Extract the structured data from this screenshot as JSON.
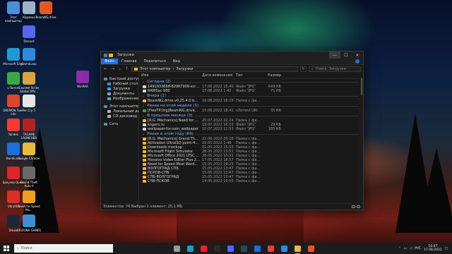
{
  "desktop": {
    "icons": [
      {
        "label": "Этот компьютер",
        "color": "#4a90d9"
      },
      {
        "label": "Корзина",
        "color": "#9fb3c8"
      },
      {
        "label": "BeamNG.drive",
        "color": "#e35a20"
      },
      {
        "label": "Discord",
        "color": "#5865f2"
      },
      {
        "label": "Microsoft Edge",
        "color": "#1f9ad6"
      },
      {
        "label": "GameLoop",
        "color": "#2e8bd8"
      },
      {
        "label": "u-Torrent",
        "color": "#3aa844"
      },
      {
        "label": "Counter-Strike Global Offe...",
        "color": "#d9a43a"
      },
      {
        "label": "DAEMON Tools Lite",
        "color": "#e0432f"
      },
      {
        "label": "Far Cry 5",
        "color": "#e6e6e6"
      },
      {
        "label": "Yandex",
        "color": "#ff3b30"
      },
      {
        "label": "TAGAME LAUNCHER",
        "color": "#b22222"
      },
      {
        "label": "Bandicam",
        "color": "#1e6fd9"
      },
      {
        "label": "Google Chrome",
        "color": "#e8b93c"
      },
      {
        "label": "Браузер Opera",
        "color": "#e0242b"
      },
      {
        "label": "Grand Theft Auto V",
        "color": "#6a6a6a"
      },
      {
        "label": "UltraISO",
        "color": "#d93025"
      },
      {
        "label": "Need for Speed Mo...",
        "color": "#f0a020"
      },
      {
        "label": "Steam",
        "color": "#1b2838"
      },
      {
        "label": "ARIZONA GAMES",
        "color": "#3d8fd6"
      },
      {
        "label": "WinRAR",
        "color": "#8b2fa8"
      }
    ]
  },
  "window": {
    "title": "Загрузки",
    "controls": {
      "minimize": "—",
      "maximize": "☐",
      "close": "✕"
    },
    "ribbon_tabs": [
      "Файл",
      "Главная",
      "Поделиться",
      "Вид"
    ],
    "address": {
      "path_root": "Этот компьютер",
      "separator": "›",
      "path_current": "Загрузки"
    },
    "search_placeholder": "Поиск: Загрузки",
    "sidebar": [
      {
        "label": "Быстрый доступ",
        "color": "#4a90d9",
        "indent": false
      },
      {
        "label": "Рабочий стол",
        "color": "#4a90d9",
        "indent": true
      },
      {
        "label": "Загрузки",
        "color": "#3b9cf0",
        "indent": true
      },
      {
        "label": "Документы",
        "color": "#8aa9c8",
        "indent": true
      },
      {
        "label": "Изображения",
        "color": "#4ab0c4",
        "indent": true
      },
      {
        "label": "",
        "color": "",
        "indent": false
      },
      {
        "label": "Этот компьютер",
        "color": "#4a90d9",
        "indent": false
      },
      {
        "label": "Локальный диск",
        "color": "#b8b8b8",
        "indent": true
      },
      {
        "label": "CD-дисковод (D:)",
        "color": "#b8b8b8",
        "indent": true
      },
      {
        "label": "",
        "color": "",
        "indent": false
      },
      {
        "label": "Сеть",
        "color": "#4a90d9",
        "indent": false
      }
    ],
    "columns": {
      "name": "Имя",
      "date": "Дата изменения",
      "type": "Тип",
      "size": "Размер"
    },
    "groups": [
      {
        "label": "Сегодня (2)",
        "rows": [
          {
            "name": "1491933668-82987909-screenshot-2",
            "date": "17.08.2022 15:40",
            "type": "Файл \"JPG\"",
            "size": "649 КБ",
            "color": "#d9d9d9"
          },
          {
            "name": "RAW5ac-980",
            "date": "17.08.2022 1:42",
            "type": "Файл \"JPG\"",
            "size": "71 КБ",
            "color": "#d9d9d9"
          }
        ]
      },
      {
        "label": "Вчера (1)",
        "rows": [
          {
            "name": "BeamNG.drive.v0.25.4.0 by Pioneer",
            "date": "16.08.2022 16:19",
            "type": "Папка с файлами",
            "size": "",
            "color": "#e8b93c"
          }
        ]
      },
      {
        "label": "Ранее на этой неделе (1)",
        "rows": [
          {
            "name": "[FreeTP.Org]BeamNG.drive_v0.25.4.0_by_...",
            "date": "15.08.2022 18:41",
            "type": "uTorrent URI",
            "size": "35 КБ",
            "color": "#3aa844"
          }
        ]
      },
      {
        "label": "В прошлом месяце (3)",
        "rows": [
          {
            "name": "[R.G. Mechanics] Need for Speed Under...",
            "date": "20.07.2022 22:24",
            "type": "Папка с файлами",
            "size": "",
            "color": "#e8b93c"
          },
          {
            "name": "kogoro.ru",
            "date": "19.07.2022 16:19",
            "type": "Файл \"JPG\"",
            "size": "29 КБ",
            "color": "#d9d9d9"
          },
          {
            "name": "wallpaper-for-com_wallpaper",
            "date": "10.07.2022 11:53",
            "type": "Файл \"JPG\"",
            "size": "185 КБ",
            "color": "#d9d9d9"
          }
        ]
      },
      {
        "label": "Ранее в этом году (69)",
        "rows": [
          {
            "name": "[R.G. Mechanics] Grand Theft Auto V",
            "date": "22.06.2022 20:28",
            "type": "Папка с файлами",
            "size": "",
            "color": "#e8b93c"
          },
          {
            "name": "Aktivation UltraISO-point-4074",
            "date": "05.05.2022 1:48",
            "type": "Папка с файлами",
            "size": "",
            "color": "#e8b93c"
          },
          {
            "name": "Downloads mockup",
            "date": "01.05.2022 15:03",
            "type": "Папка с файлами",
            "size": "",
            "color": "#e8b93c"
          },
          {
            "name": "Microsoft Flight Simulator",
            "date": "28.05.2022 13:51",
            "type": "Папка с файлами",
            "size": "",
            "color": "#e8b93c"
          },
          {
            "name": "Microsoft Office 2021 LTSC Professional ...",
            "date": "28.05.2022 15:31",
            "type": "Папка с файлами",
            "size": "",
            "color": "#e8b93c"
          },
          {
            "name": "Mosaivo Video Editor Plus 22.1.0 RePack (...",
            "date": "17.05.2022 18:57",
            "type": "Папка с файлами",
            "size": "",
            "color": "#e8b93c"
          },
          {
            "name": "Need for Speed Most Wanted by Igruha",
            "date": "15.05.2022 19:23",
            "type": "Папка с файлами",
            "size": "",
            "color": "#e8b93c"
          },
          {
            "name": "ВОЛГОГРАД СПБ",
            "date": "15.05.2022 13:47",
            "type": "Папка с файлами",
            "size": "",
            "color": "#e8b93c"
          },
          {
            "name": "ПСКОВ-СПБ",
            "date": "15.05.2022 13:47",
            "type": "Папка с файлами",
            "size": "",
            "color": "#e8b93c"
          },
          {
            "name": "СПБ-ВОЛГОГРАД",
            "date": "15.05.2022 13:47",
            "type": "Папка с файлами",
            "size": "",
            "color": "#e8b93c"
          },
          {
            "name": "СПБ-ПСКОВ",
            "date": "14.05.2022 10:55",
            "type": "Папка с файлами",
            "size": "",
            "color": "#e8b93c"
          }
        ]
      }
    ],
    "status": "Элементов: 76   Выбран 1 элемент: 25,1 МБ"
  },
  "taskbar": {
    "search_placeholder": "Поиск",
    "apps": [
      {
        "name": "task-view",
        "color": "#9a9a9a",
        "active": false
      },
      {
        "name": "edge",
        "color": "#1f9ad6",
        "active": false
      },
      {
        "name": "opera",
        "color": "#e0242b",
        "active": false
      },
      {
        "name": "epic",
        "color": "#2a2a2a",
        "active": false
      },
      {
        "name": "discord",
        "color": "#5865f2",
        "active": false
      },
      {
        "name": "steam",
        "color": "#2a475e",
        "active": false
      },
      {
        "name": "bandicam",
        "color": "#1e6fd9",
        "active": false
      },
      {
        "name": "yandex",
        "color": "#ff3b30",
        "active": false
      },
      {
        "name": "gameloop",
        "color": "#2e8bd8",
        "active": false
      },
      {
        "name": "explorer",
        "color": "#e8b93c",
        "active": true
      },
      {
        "name": "beamng",
        "color": "#e35a20",
        "active": false
      }
    ],
    "tray": {
      "lang": "РУС",
      "time": "16:47",
      "date": "17.08.2022"
    }
  },
  "accent_color": "#1a73e8"
}
